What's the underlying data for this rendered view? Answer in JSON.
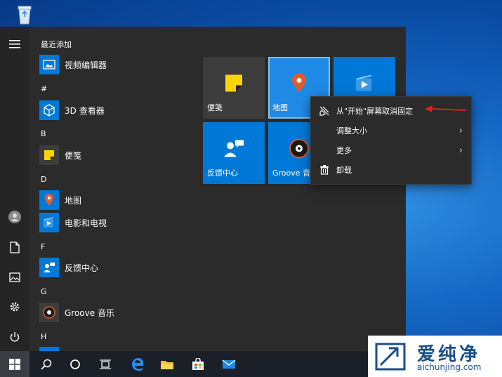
{
  "applist": {
    "recent_header": "最近添加",
    "groups": [
      {
        "letter": "#",
        "apps": [
          "3D 查看器"
        ]
      },
      {
        "letter": "B",
        "apps": [
          "便笺"
        ]
      },
      {
        "letter": "D",
        "apps": [
          "地图",
          "电影和电视"
        ]
      },
      {
        "letter": "F",
        "apps": [
          "反馈中心"
        ]
      },
      {
        "letter": "G",
        "apps": [
          "Groove 音乐"
        ]
      },
      {
        "letter": "H",
        "apps": []
      }
    ],
    "recent_app": "视频编辑器"
  },
  "tiles": {
    "sticky_notes": "便笺",
    "maps": "地图",
    "feedback_hub": "反馈中心",
    "groove": "Groove 音乐"
  },
  "context_menu": {
    "unpin": "从\"开始\"屏幕取消固定",
    "resize": "调整大小",
    "more": "更多",
    "uninstall": "卸载"
  },
  "watermark": {
    "brand": "爱纯净",
    "domain": "aichunjing.com"
  },
  "colors": {
    "tile_blue": "#0078d7",
    "tile_dark": "#3c3c3c",
    "accent_arrow": "#e02020"
  }
}
